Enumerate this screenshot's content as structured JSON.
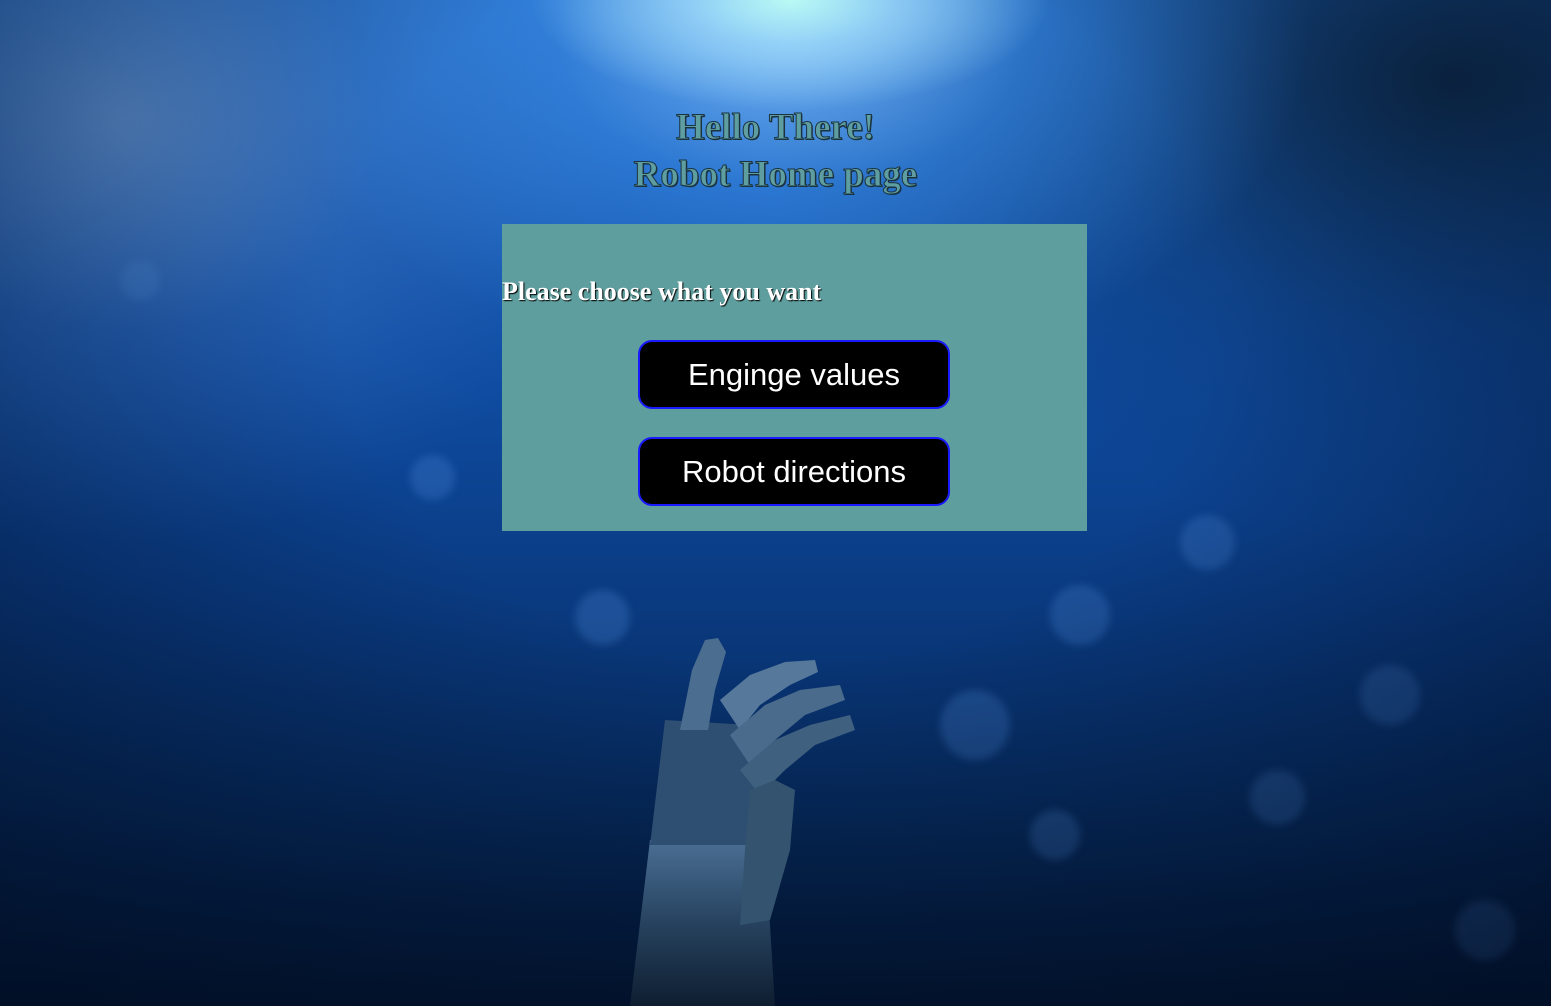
{
  "header": {
    "greeting": "Hello There!",
    "title": "Robot Home page"
  },
  "panel": {
    "prompt": "Please choose what you want",
    "buttons": [
      {
        "label": "Enginge values"
      },
      {
        "label": "Robot directions"
      }
    ]
  },
  "colors": {
    "panel_background": "#5f9e9e",
    "button_background": "#000000",
    "button_border": "#1a1aff",
    "heading_text": "#5f9ea0"
  },
  "background": {
    "icon": "robot-hand-image"
  }
}
